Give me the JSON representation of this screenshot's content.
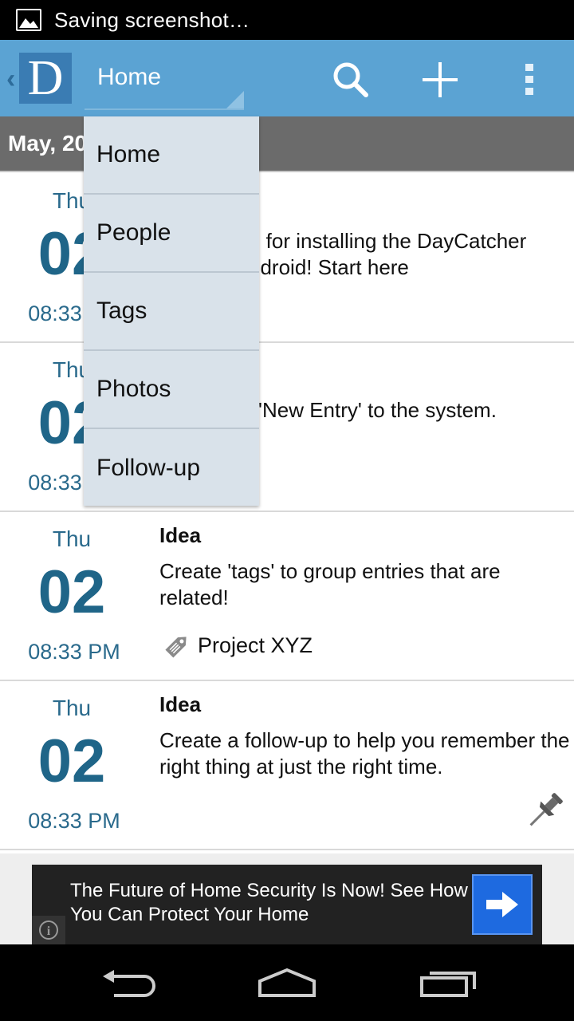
{
  "status_bar": {
    "text": "Saving screenshot…"
  },
  "action_bar": {
    "logo_letter": "D",
    "nav_title": "Home"
  },
  "date_header": "May, 20",
  "dropdown": {
    "items": [
      "Home",
      "People",
      "Tags",
      "Photos",
      "Follow-up"
    ]
  },
  "entries": [
    {
      "dow": "Thu",
      "day": "02",
      "time": "08:33 PM",
      "title": "",
      "body": "u for installing the DayCatcher ndroid!   Start here"
    },
    {
      "dow": "Thu",
      "day": "02",
      "time": "08:33 PM",
      "title": "",
      "body": "'New Entry' to the system."
    },
    {
      "dow": "Thu",
      "day": "02",
      "time": "08:33 PM",
      "title": "Idea",
      "body": "Create 'tags' to group entries that are related!",
      "tag": "Project XYZ"
    },
    {
      "dow": "Thu",
      "day": "02",
      "time": "08:33 PM",
      "title": "Idea",
      "body": "Create a follow-up to help you remember the right thing at just the right time."
    }
  ],
  "ad": {
    "text": "The Future of Home Security Is Now! See How You Can Protect Your Home",
    "info_icon": "i"
  },
  "icons": {
    "status": "image-icon",
    "search": "search-icon",
    "add": "plus-icon",
    "overflow": "overflow-menu-icon",
    "tag": "tag-icon",
    "pin": "pushpin-icon",
    "back": "back-nav-icon",
    "home": "home-nav-icon",
    "recents": "recents-nav-icon"
  },
  "colors": {
    "action_bar": "#5ba3d3",
    "accent_text": "#1f6588",
    "dropdown_bg": "#d9e2ea",
    "date_header": "#6b6b6b",
    "ad_button": "#1e6ae0"
  }
}
